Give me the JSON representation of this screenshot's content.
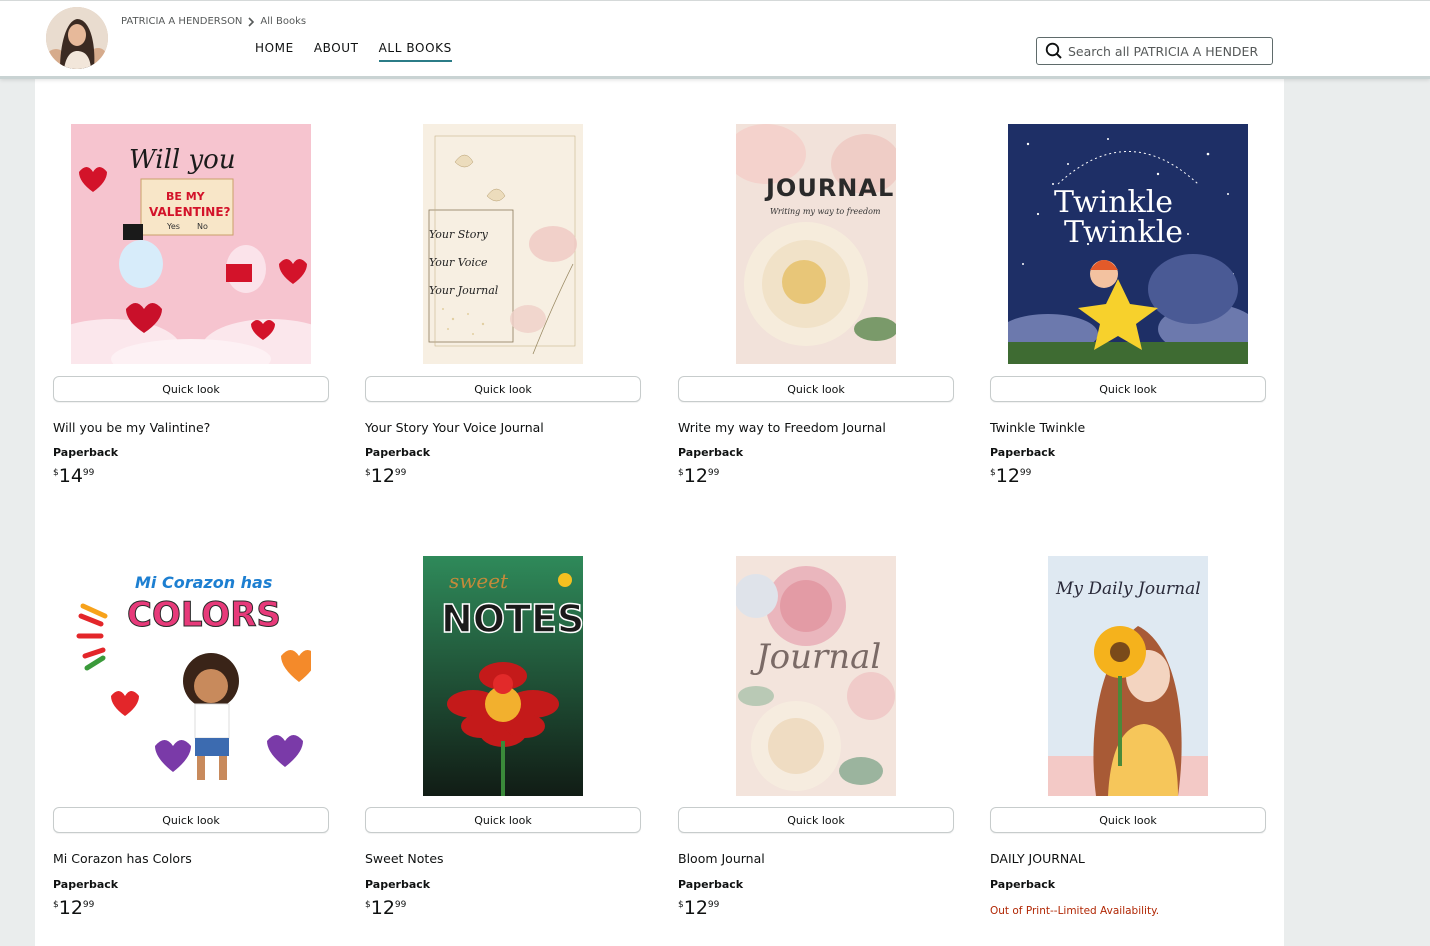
{
  "header": {
    "store_name": "PATRICIA A HENDERSON",
    "breadcrumb_current": "All Books",
    "nav": [
      {
        "label": "HOME",
        "active": false
      },
      {
        "label": "ABOUT",
        "active": false
      },
      {
        "label": "ALL BOOKS",
        "active": true
      }
    ],
    "search_placeholder": "Search all PATRICIA A HENDERSON"
  },
  "books": [
    {
      "title": "Will you be my Valintine?",
      "format": "Paperback",
      "currency": "$",
      "price_whole": "14",
      "price_fraction": "99",
      "quick_look": "Quick look",
      "cover_text": [
        "Will you",
        "BE MY",
        "VALENTINE?",
        "Yes",
        "No"
      ]
    },
    {
      "title": "Your Story Your Voice Journal",
      "format": "Paperback",
      "currency": "$",
      "price_whole": "12",
      "price_fraction": "99",
      "quick_look": "Quick look",
      "cover_text": [
        "Your Story",
        "Your Voice",
        "Your Journal"
      ]
    },
    {
      "title": "Write my way to Freedom Journal",
      "format": "Paperback",
      "currency": "$",
      "price_whole": "12",
      "price_fraction": "99",
      "quick_look": "Quick look",
      "cover_text": [
        "JOURNAL",
        "Writing my way to freedom"
      ]
    },
    {
      "title": "Twinkle Twinkle",
      "format": "Paperback",
      "currency": "$",
      "price_whole": "12",
      "price_fraction": "99",
      "quick_look": "Quick look",
      "cover_text": [
        "Twinkle",
        "Twinkle"
      ]
    },
    {
      "title": "Mi Corazon has Colors",
      "format": "Paperback",
      "currency": "$",
      "price_whole": "12",
      "price_fraction": "99",
      "quick_look": "Quick look",
      "cover_text": [
        "Mi Corazon has",
        "COLORS"
      ]
    },
    {
      "title": "Sweet Notes",
      "format": "Paperback",
      "currency": "$",
      "price_whole": "12",
      "price_fraction": "99",
      "quick_look": "Quick look",
      "cover_text": [
        "sweet",
        "NOTES"
      ]
    },
    {
      "title": "Bloom Journal",
      "format": "Paperback",
      "currency": "$",
      "price_whole": "12",
      "price_fraction": "99",
      "quick_look": "Quick look",
      "cover_text": [
        "Journal"
      ]
    },
    {
      "title": "DAILY JOURNAL",
      "format": "Paperback",
      "availability": "Out of Print--Limited Availability.",
      "quick_look": "Quick look",
      "cover_text": [
        "My Daily Journal"
      ]
    }
  ],
  "colors": {
    "accent": "#2b7c87",
    "out_of_print": "#b12704",
    "page_bg": "#eaeded"
  }
}
